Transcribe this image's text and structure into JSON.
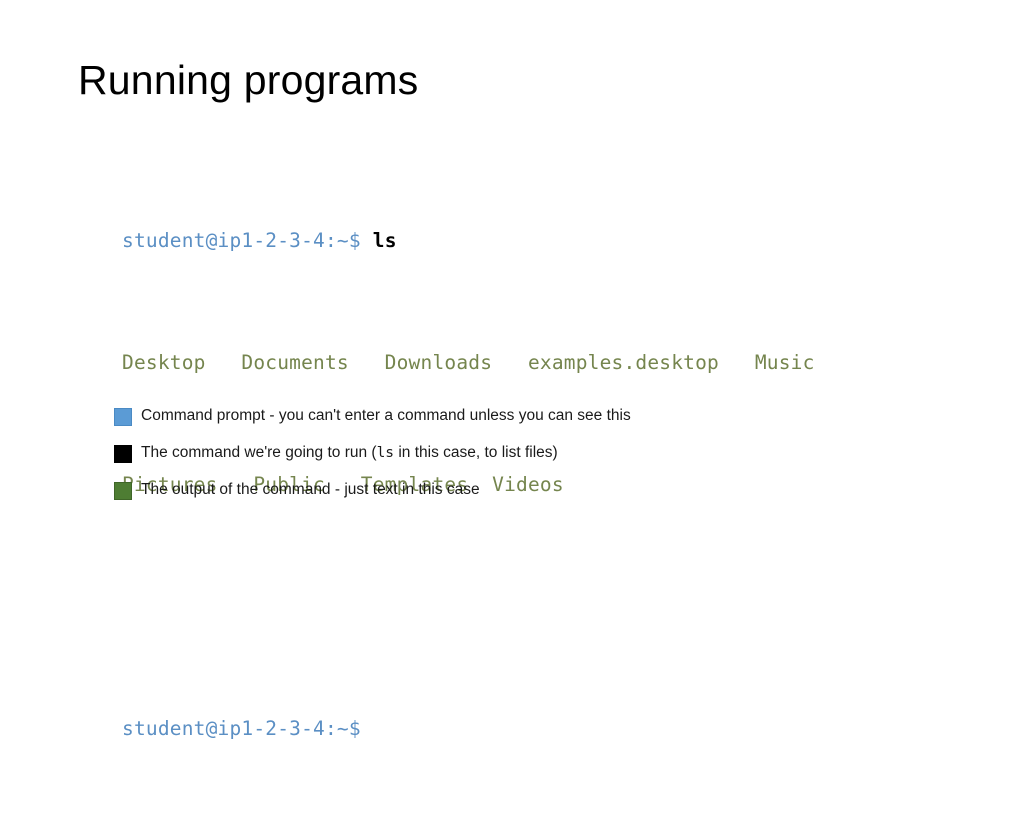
{
  "slide": {
    "title": "Running programs",
    "background_color": "#ffffff"
  },
  "terminal": {
    "prompt_color": "#5b8fc4",
    "command_color": "#000000",
    "output_color": "#75854e",
    "lines": [
      {
        "type": "prompt-command",
        "prompt": "student@ip1-2-3-4:~$ ",
        "command": "ls"
      },
      {
        "type": "output",
        "text": "Desktop   Documents   Downloads   examples.desktop   Music"
      },
      {
        "type": "output",
        "text": "Pictures   Public   Templates  Videos"
      },
      {
        "type": "blank",
        "text": ""
      },
      {
        "type": "prompt",
        "prompt": "student@ip1-2-3-4:~$"
      }
    ],
    "line1_prompt": "student@ip1-2-3-4:~$ ",
    "line1_command": "ls",
    "line2_output": "Desktop   Documents   Downloads   examples.desktop   Music",
    "line3_output": "Pictures   Public   Templates  Videos",
    "line5_prompt": "student@ip1-2-3-4:~$"
  },
  "legend": {
    "items": [
      {
        "swatch_color": "#5b9bd5",
        "swatch_name": "blue",
        "text_before": "Command prompt - you can't enter a command unless you can see this",
        "mono": "",
        "text_after": ""
      },
      {
        "swatch_color": "#000000",
        "swatch_name": "black",
        "text_before": "The command we're going to run (",
        "mono": "ls",
        "text_after": " in this case, to list files)"
      },
      {
        "swatch_color": "#4e7d33",
        "swatch_name": "green",
        "text_before": "The output of the command - just text in this case",
        "mono": "",
        "text_after": ""
      }
    ]
  }
}
